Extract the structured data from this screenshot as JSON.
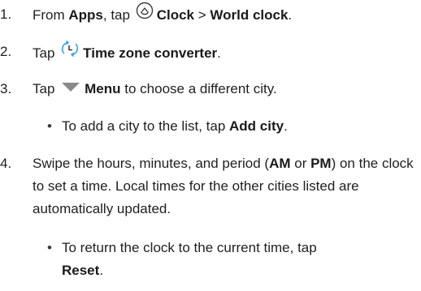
{
  "steps": [
    {
      "number": "1.",
      "t1": "From ",
      "b1": "Apps",
      "t2": ", tap ",
      "icon": "clock-app-icon",
      "b2": "Clock",
      "sep": " > ",
      "b3": "World clock",
      "t3": "."
    },
    {
      "number": "2.",
      "t1": "Tap ",
      "icon": "time-zone-converter-icon",
      "b1": "Time zone converter",
      "t2": "."
    },
    {
      "number": "3.",
      "t1": "Tap ",
      "icon": "menu-dropdown-triangle-icon",
      "b1": "Menu",
      "t2": " to choose a different city.",
      "bullet": {
        "t1": "To add a city to the list, tap ",
        "b1": "Add city",
        "t2": "."
      }
    },
    {
      "number": "4.",
      "t1": "Swipe the hours, minutes, and period (",
      "b1": "AM",
      "t2": " or ",
      "b2": "PM",
      "t3": ") on the clock to set a time. Local times for the other cities listed are automatically updated.",
      "bullet": {
        "t1": "To return the clock to the current time, tap ",
        "b1": "Reset",
        "t2": "."
      }
    }
  ],
  "bullet_char": "•",
  "colors": {
    "text": "#1f1f1f",
    "icon_stroke": "#3d3d3d",
    "triangle": "#8a8a8a",
    "converter_arrow": "#3aa0d8"
  }
}
